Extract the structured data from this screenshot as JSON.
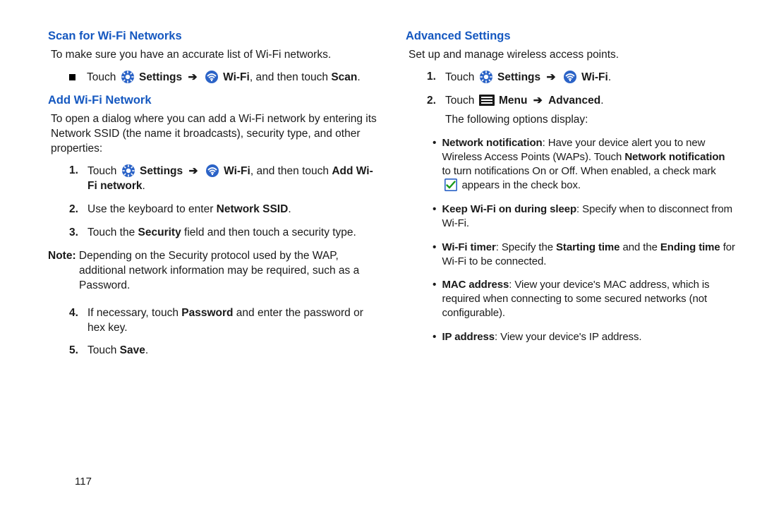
{
  "leftCol": {
    "h1": "Scan for Wi-Fi Networks",
    "p1": "To make sure you have an accurate list of Wi-Fi networks.",
    "bullet_touch": "Touch",
    "bullet_settings": "Settings",
    "bullet_wifi": "Wi-Fi",
    "bullet_tail": ", and then touch ",
    "bullet_scan": "Scan",
    "h2": "Add Wi-Fi Network",
    "p2": "To open a dialog where you can add a Wi-Fi network by entering its Network SSID (the name it broadcasts), security type, and other properties:",
    "step1_touch": "Touch",
    "step1_settings": "Settings",
    "step1_wifi": "Wi-Fi",
    "step1_tail": ", and then touch ",
    "step1_add": "Add Wi-Fi network",
    "step2_a": "Use the keyboard to enter ",
    "step2_b": "Network SSID",
    "step3_a": "Touch the ",
    "step3_b": "Security",
    "step3_c": " field and then touch a security type.",
    "note_label": "Note: ",
    "note_body": "Depending on the Security protocol used by the WAP, additional network information may be required, such as a Password.",
    "step4_a": "If necessary, touch ",
    "step4_b": "Password",
    "step4_c": " and enter the password or hex key.",
    "step5_a": "Touch ",
    "step5_b": "Save",
    "num1": "1.",
    "num2": "2.",
    "num3": "3.",
    "num4": "4.",
    "num5": "5."
  },
  "rightCol": {
    "h1": "Advanced Settings",
    "p1": "Set up and manage wireless access points.",
    "s1_touch": "Touch",
    "s1_settings": "Settings",
    "s1_wifi": "Wi-Fi",
    "s2_touch": "Touch",
    "s2_menu": "Menu",
    "s2_adv": "Advanced",
    "s2_after": "The following options display:",
    "b1_lbl": "Network notification",
    "b1_a": ": Have your device alert you to new Wireless Access Points (WAPs). Touch ",
    "b1_b": "Network notification",
    "b1_c": " to turn notifications On or Off. When enabled, a check mark ",
    "b1_d": " appears in the check box.",
    "b2_lbl": "Keep Wi-Fi on during sleep",
    "b2_a": ": Specify when to disconnect from Wi-Fi.",
    "b3_lbl": "Wi-Fi timer",
    "b3_a": ": Specify the ",
    "b3_b": "Starting time",
    "b3_c": " and the ",
    "b3_d": "Ending time",
    "b3_e": " for Wi-Fi to be connected.",
    "b4_lbl": "MAC address",
    "b4_a": ": View your device's MAC address, which is required when connecting to some secured networks (not configurable).",
    "b5_lbl": "IP address",
    "b5_a": ": View your device's IP address.",
    "num1": "1.",
    "num2": "2.",
    "arrow": "➔",
    "bullet": "•"
  },
  "pageNumber": "117",
  "arrow": "➔",
  "period": "."
}
